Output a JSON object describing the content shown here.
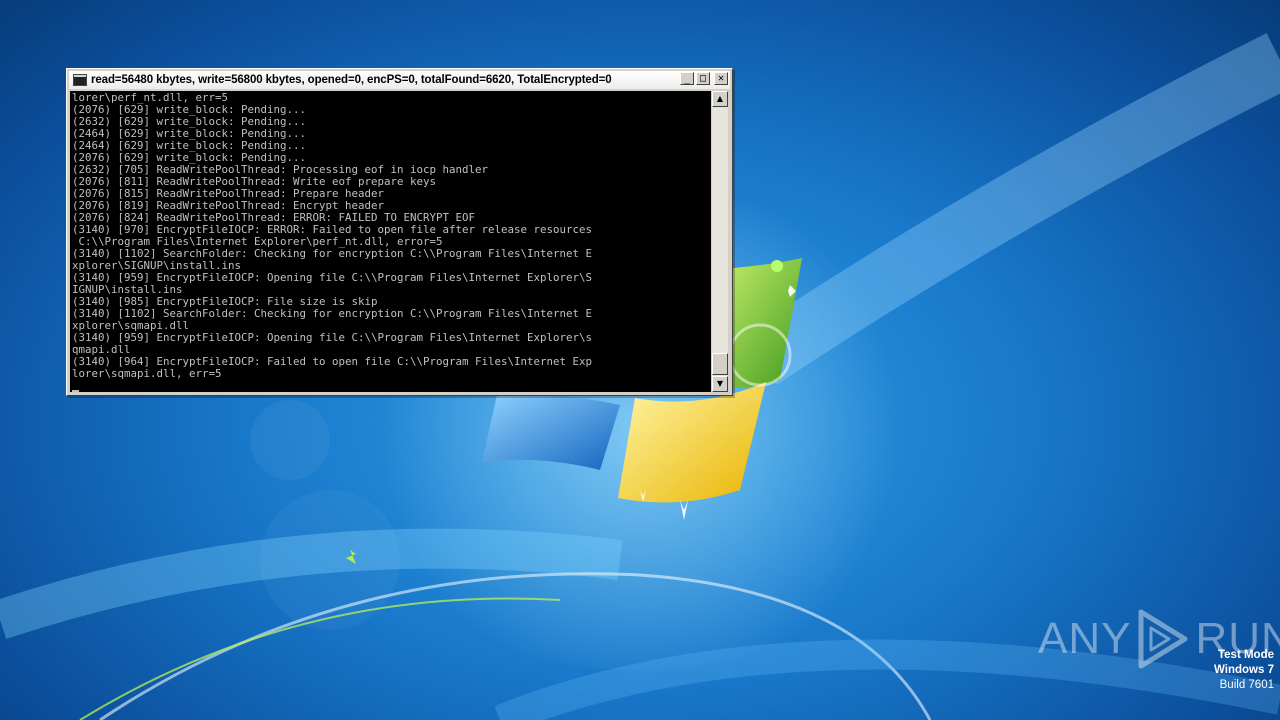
{
  "console": {
    "title": "read=56480 kbytes, write=56800 kbytes, opened=0, encPS=0, totalFound=6620, TotalEncrypted=0",
    "controls": {
      "minimize": "_",
      "maximize": "□",
      "close": "✕"
    },
    "lines": [
      "lorer\\perf_nt.dll, err=5",
      "(2076) [629] write_block: Pending...",
      "(2632) [629] write_block: Pending...",
      "(2464) [629] write_block: Pending...",
      "(2464) [629] write_block: Pending...",
      "(2076) [629] write_block: Pending...",
      "(2632) [705] ReadWritePoolThread: Processing eof in iocp handler",
      "(2076) [811] ReadWritePoolThread: Write eof prepare keys",
      "(2076) [815] ReadWritePoolThread: Prepare header",
      "(2076) [819] ReadWritePoolThread: Encrypt header",
      "(2076) [824] ReadWritePoolThread: ERROR: FAILED TO ENCRYPT EOF",
      "(3140) [970] EncryptFileIOCP: ERROR: Failed to open file after release resources",
      " C:\\\\Program Files\\Internet Explorer\\perf_nt.dll, error=5",
      "(3140) [1102] SearchFolder: Checking for encryption C:\\\\Program Files\\Internet E",
      "xplorer\\SIGNUP\\install.ins",
      "(3140) [959] EncryptFileIOCP: Opening file C:\\\\Program Files\\Internet Explorer\\S",
      "IGNUP\\install.ins",
      "(3140) [985] EncryptFileIOCP: File size is skip",
      "(3140) [1102] SearchFolder: Checking for encryption C:\\\\Program Files\\Internet E",
      "xplorer\\sqmapi.dll",
      "(3140) [959] EncryptFileIOCP: Opening file C:\\\\Program Files\\Internet Explorer\\s",
      "qmapi.dll",
      "(3140) [964] EncryptFileIOCP: Failed to open file C:\\\\Program Files\\Internet Exp",
      "lorer\\sqmapi.dll, err=5",
      ""
    ]
  },
  "watermark": {
    "left": "ANY",
    "right": "RUN"
  },
  "os_info": {
    "mode": "Test Mode",
    "os": "Windows 7",
    "build": "Build 7601"
  }
}
